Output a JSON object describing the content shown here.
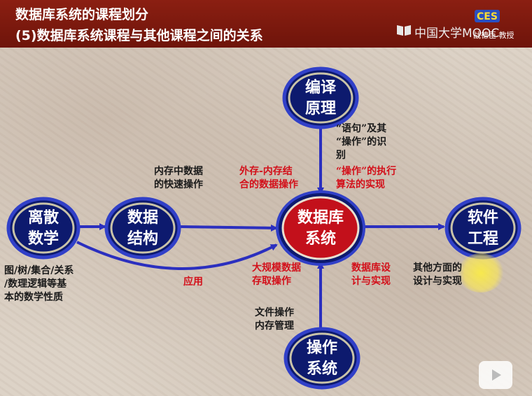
{
  "header": {
    "title": "数据库系统的课程划分",
    "subtitle": "(5)数据库系统课程与其他课程之间的关系",
    "watermark": "中国大学MOOC",
    "logo_sub": "战德臣 教授"
  },
  "nodes": {
    "compiler": "编译\n原理",
    "discrete": "离散\n数学",
    "datastruct": "数据\n结构",
    "database": "数据库\n系统",
    "software": "软件\n工程",
    "os": "操作\n系统"
  },
  "labels": {
    "compiler_top": "“语句”及其\n“操作”的识\n别",
    "compiler_bottom": "“操作”的执行\n算法的实现",
    "ds_black": "内存中数据\n的快速操作",
    "ds_red": "外存-内存结\n合的数据操作",
    "discrete_desc": "图/树/集合/关系\n/数理逻辑等基\n本的数学性质",
    "apply": "应用",
    "bigdata": "大规模数据\n存取操作",
    "db_design": "数据库设\n计与实现",
    "other_design": "其他方面的\n设计与实现",
    "os_desc": "文件操作\n内存管理"
  },
  "colors": {
    "header": "#7a180d",
    "node_fill": "#0d1a6e",
    "node_ring": "#c9c3a8",
    "db_fill": "#c3101b",
    "arrow": "#2b2fbf",
    "red_text": "#d3101a"
  }
}
